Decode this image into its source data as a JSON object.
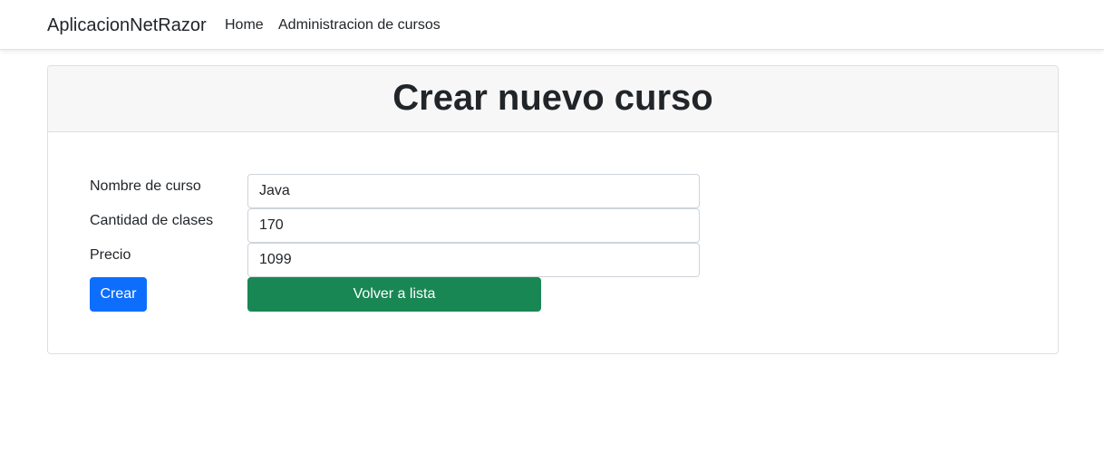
{
  "navbar": {
    "brand": "AplicacionNetRazor",
    "links": [
      {
        "label": "Home"
      },
      {
        "label": "Administracion de cursos"
      }
    ]
  },
  "card": {
    "title": "Crear nuevo curso"
  },
  "form": {
    "fields": [
      {
        "label": "Nombre de curso",
        "value": "Java"
      },
      {
        "label": "Cantidad de clases",
        "value": "170"
      },
      {
        "label": "Precio",
        "value": "1099"
      }
    ],
    "submit_label": "Crear",
    "back_label": "Volver a lista"
  },
  "colors": {
    "primary": "#0d6efd",
    "success": "#198754",
    "header_bg": "#f7f7f7"
  }
}
